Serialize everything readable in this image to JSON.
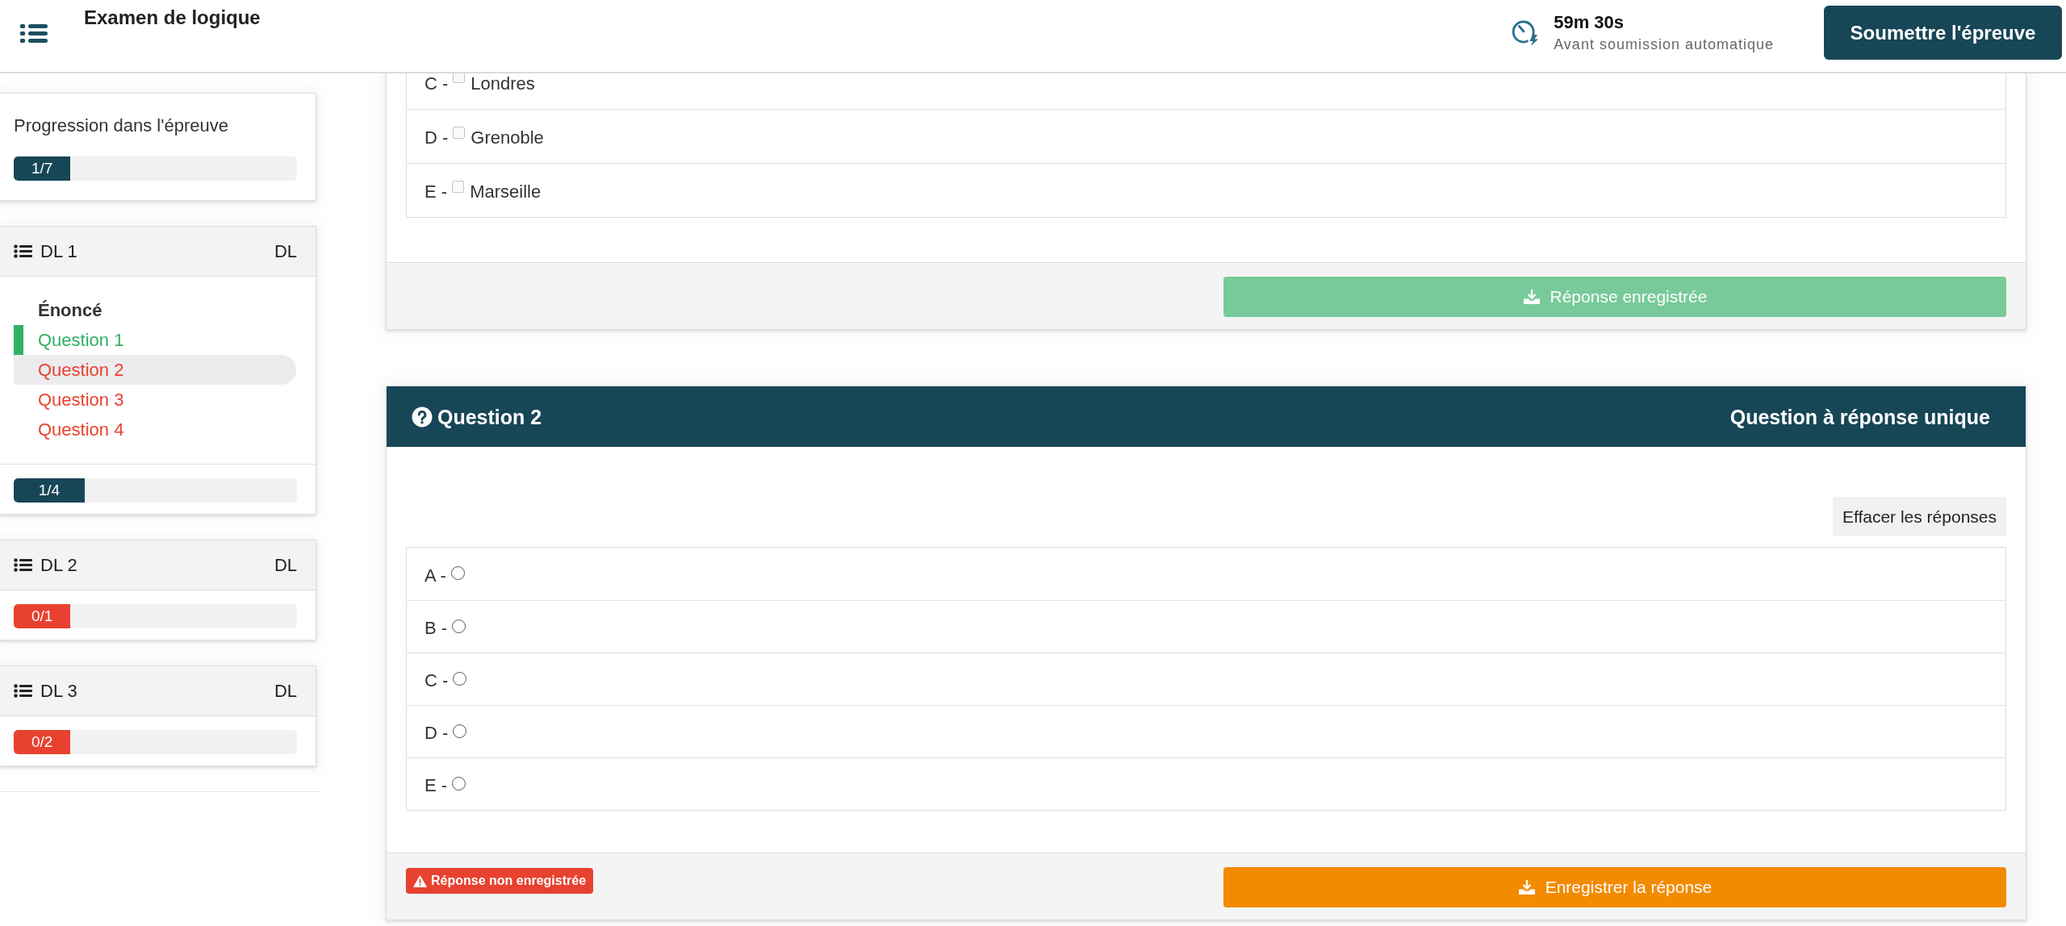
{
  "header": {
    "title": "Examen de logique",
    "timer": {
      "remaining": "59m 30s",
      "caption": "Avant soumission automatique"
    },
    "submit_button": "Soumettre l'épreuve"
  },
  "sidebar": {
    "overall": {
      "label": "Progression dans l'épreuve",
      "progress": {
        "text": "1/7",
        "level": 0.2,
        "color": "#174656"
      }
    },
    "sections": [
      {
        "title": "DL 1",
        "tag": "DL",
        "items": [
          {
            "kind": "statement",
            "label": "Énoncé",
            "selected": false
          },
          {
            "kind": "question",
            "label": "Question 1",
            "answered": true,
            "selected": false
          },
          {
            "kind": "question",
            "label": "Question 2",
            "answered": false,
            "selected": true
          },
          {
            "kind": "question",
            "label": "Question 3",
            "answered": false,
            "selected": false
          },
          {
            "kind": "question",
            "label": "Question 4",
            "answered": false,
            "selected": false
          }
        ],
        "progress": {
          "text": "1/4",
          "level": 0.25,
          "color": "#174656"
        }
      },
      {
        "title": "DL 2",
        "tag": "DL",
        "progress": {
          "text": "0/1",
          "level": 0.2,
          "color": "#e8412f"
        }
      },
      {
        "title": "DL 3",
        "tag": "DL",
        "progress": {
          "text": "0/2",
          "level": 0.2,
          "color": "#e8412f"
        }
      }
    ]
  },
  "questions": [
    {
      "kind": "multiple",
      "options": [
        {
          "prefix": "C -",
          "label": "Londres",
          "checked": false
        },
        {
          "prefix": "D -",
          "label": "Grenoble",
          "checked": false
        },
        {
          "prefix": "E -",
          "label": "Marseille",
          "checked": false
        }
      ],
      "saved": true,
      "save_button": "Réponse enregistrée"
    },
    {
      "kind": "single",
      "title": "Question 2",
      "type_label": "Question à réponse unique",
      "clear_button": "Effacer les réponses",
      "options": [
        {
          "prefix": "A -",
          "selected": false
        },
        {
          "prefix": "B -",
          "selected": false
        },
        {
          "prefix": "C -",
          "selected": false
        },
        {
          "prefix": "D -",
          "selected": false
        },
        {
          "prefix": "E -",
          "selected": false
        }
      ],
      "saved": false,
      "warning": "Réponse non enregistrée",
      "save_button": "Enregistrer la réponse"
    }
  ]
}
